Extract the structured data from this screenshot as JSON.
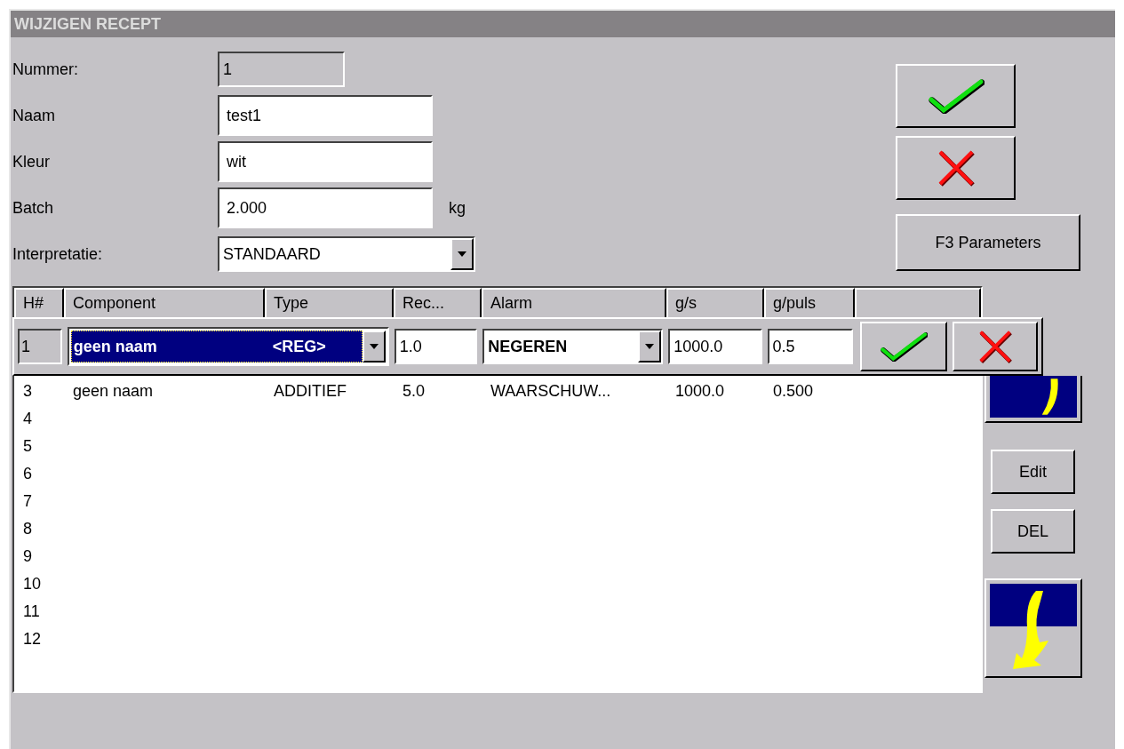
{
  "window": {
    "title": "WIJZIGEN RECEPT"
  },
  "form": {
    "fields": [
      {
        "label": "Nummer:",
        "value": "1",
        "kind": "readonly"
      },
      {
        "label": "Naam",
        "value": "test1",
        "kind": "text"
      },
      {
        "label": "Kleur",
        "value": "wit",
        "kind": "text"
      },
      {
        "label": "Batch",
        "value": "2.000",
        "kind": "text",
        "unit": "kg"
      },
      {
        "label": "Interpretatie:",
        "value": "STANDAARD",
        "kind": "dropdown"
      }
    ]
  },
  "parameters_button": "F3 Parameters",
  "table": {
    "columns": [
      "H#",
      "Component",
      "Type",
      "Rec...",
      "Alarm",
      "g/s",
      "g/puls"
    ],
    "edit_row": {
      "number": "1",
      "component": "geen naam",
      "component_tag": "<REG>",
      "rec": "1.0",
      "alarm": "NEGEREN",
      "gs": "1000.0",
      "gpuls": "0.5"
    },
    "rows": [
      {
        "cells": [
          "3",
          "geen naam",
          "ADDITIEF",
          "5.0",
          "WAARSCHUW...",
          "1000.0",
          "0.500"
        ]
      },
      {
        "cells": [
          "4"
        ]
      },
      {
        "cells": [
          "5"
        ]
      },
      {
        "cells": [
          "6"
        ]
      },
      {
        "cells": [
          "7"
        ]
      },
      {
        "cells": [
          "8"
        ]
      },
      {
        "cells": [
          "9"
        ]
      },
      {
        "cells": [
          "10"
        ]
      },
      {
        "cells": [
          "11"
        ]
      },
      {
        "cells": [
          "12"
        ]
      }
    ]
  },
  "side_buttons": [
    "Edit",
    "DEL"
  ]
}
